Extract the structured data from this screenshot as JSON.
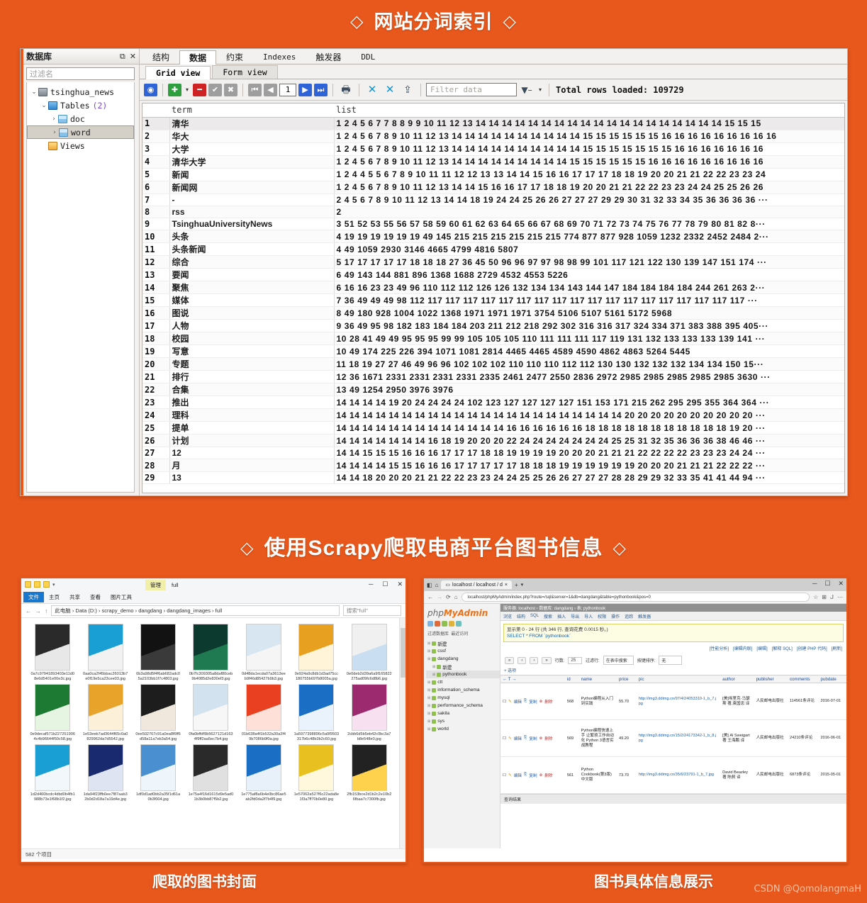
{
  "titles": {
    "section1": "网站分词索引",
    "section2": "使用Scrapy爬取电商平台图书信息",
    "diamond": "◇"
  },
  "db_tool": {
    "tree": {
      "header_title": "数据库",
      "header_restore": "⧉",
      "header_close": "✕",
      "filter_placeholder": "过滤名",
      "nodes": [
        {
          "label": "tsinghua_news",
          "icon": "database-icon",
          "arrow": "⌄",
          "indent": 0,
          "count": "",
          "selected": false
        },
        {
          "label": "Tables",
          "icon": "tables-folder-icon",
          "arrow": "⌄",
          "indent": 1,
          "count": "(2)",
          "selected": false
        },
        {
          "label": "doc",
          "icon": "table-icon",
          "arrow": "›",
          "indent": 2,
          "count": "",
          "selected": false
        },
        {
          "label": "word",
          "icon": "table-icon",
          "arrow": "›",
          "indent": 2,
          "count": "",
          "selected": true
        },
        {
          "label": "Views",
          "icon": "views-icon",
          "arrow": "",
          "indent": 1,
          "count": "",
          "selected": false
        }
      ]
    },
    "tabs": [
      {
        "label": "结构",
        "active": false,
        "latin": false
      },
      {
        "label": "数据",
        "active": true,
        "latin": false
      },
      {
        "label": "约束",
        "active": false,
        "latin": false
      },
      {
        "label": "Indexes",
        "active": false,
        "latin": true
      },
      {
        "label": "触发器",
        "active": false,
        "latin": false
      },
      {
        "label": "DDL",
        "active": false,
        "latin": true
      }
    ],
    "subtabs": [
      {
        "label": "Grid view",
        "active": true
      },
      {
        "label": "Form view",
        "active": false
      }
    ],
    "toolbar": {
      "refresh": "◉",
      "add_row": "✚",
      "add_caret": "▾",
      "delete_row": "━",
      "commit": "✔",
      "rollback": "✖",
      "first_page": "⏮",
      "prev_page": "◀",
      "page_number": "1",
      "next_page": "▶",
      "last_page": "⏭",
      "print": "🖶",
      "collapse": "✕",
      "expand": "✕",
      "export": "⇪",
      "filter_placeholder": "Filter data",
      "filter_icon": "funnel-icon",
      "filter_caret": "▾",
      "total_rows": "Total rows loaded: 109729"
    },
    "grid": {
      "columns": [
        "term",
        "list"
      ],
      "rows": [
        {
          "n": "1",
          "term": "清华",
          "list": "1 2 4 5 6 7 7 8 8 9 9 10 11 12 13 14 14 14 14 14 14 14 14 14 14 14 14 14 14 14 14 14 14 14 15 15 15"
        },
        {
          "n": "2",
          "term": "华大",
          "list": "1 2 4 5 6 7 8 9 10 11 12 13 14 14 14 14 14 14 14 14 14 14 15 15 15 15 15 15 16 16 16 16 16 16 16 16 16"
        },
        {
          "n": "3",
          "term": "大学",
          "list": "1 2 4 5 6 7 8 9 10 11 12 13 14 14 14 14 14 14 14 14 14 14 15 15 15 15 15 15 15 16 16 16 16 16 16 16"
        },
        {
          "n": "4",
          "term": "清华大学",
          "list": "1 2 4 5 6 7 8 9 10 11 12 13 14 14 14 14 14 14 14 14 14 15 15 15 15 15 15 16 16 16 16 16 16 16 16 16"
        },
        {
          "n": "5",
          "term": "新闻",
          "list": "1 2 4 4 5 5 6 7 8 9 10 11 11 12 12 13 13 14 14 15 16 16 17 17 17 18 18 19 20 20 21 21 22 22 23 23 24"
        },
        {
          "n": "6",
          "term": "新闻网",
          "list": "1 2 4 5 6 7 8 9 10 11 12 13 14 14 15 16 16 17 17 18 18 19 20 20 21 21 22 22 23 23 24 24 25 25 26 26"
        },
        {
          "n": "7",
          "term": "-",
          "list": "2 4 5 6 7 8 9 10 11 12 13 14 14 18 19 24 24 25 26 26 27 27 27 29 29 30 31 32 33 34 35 36 36 36 36 ···"
        },
        {
          "n": "8",
          "term": "rss",
          "list": "2"
        },
        {
          "n": "9",
          "term": "TsinghuaUniversityNews",
          "list": "3 51 52 53 55 56 57 58 59 60 61 62 63 64 65 66 67 68 69 70 71 72 73 74 75 76 77 78 79 80 81 82 8···"
        },
        {
          "n": "10",
          "term": "头条",
          "list": "4 19 19 19 19 19 19 49 145 215 215 215 215 215 215 774 877 877 928 1059 1232 2332 2452 2484 2···"
        },
        {
          "n": "11",
          "term": "头条新闻",
          "list": "4 49 1059 2930 3146 4665 4799 4816 5807"
        },
        {
          "n": "12",
          "term": "综合",
          "list": "5 17 17 17 17 17 18 18 18 27 36 45 50 96 96 97 97 98 98 99 101 117 121 122 130 139 147 151 174 ···"
        },
        {
          "n": "13",
          "term": "要闻",
          "list": "6 49 143 144 881 896 1368 1688 2729 4532 4553 5226"
        },
        {
          "n": "14",
          "term": "聚焦",
          "list": "6 16 16 23 23 49 96 110 112 112 126 126 132 134 134 143 144 147 184 184 184 184 244 261 263 2···"
        },
        {
          "n": "15",
          "term": "媒体",
          "list": "7 36 49 49 49 98 112 117 117 117 117 117 117 117 117 117 117 117 117 117 117 117 117 117 117 ···"
        },
        {
          "n": "16",
          "term": "图说",
          "list": "8 49 180 928 1004 1022 1368 1971 1971 1971 3754 5106 5107 5161 5172 5968"
        },
        {
          "n": "17",
          "term": "人物",
          "list": "9 36 49 95 98 182 183 184 184 203 211 212 218 292 302 316 316 317 324 334 371 383 388 395 405···"
        },
        {
          "n": "18",
          "term": "校园",
          "list": "10 28 41 49 49 95 95 95 99 99 105 105 105 110 111 111 111 117 119 131 132 133 133 133 139 141 ···"
        },
        {
          "n": "19",
          "term": "写意",
          "list": "10 49 174 225 226 394 1071 1081 2814 4465 4465 4589 4590 4862 4863 5264 5445"
        },
        {
          "n": "20",
          "term": "专题",
          "list": "11 18 19 27 27 46 49 96 96 102 102 102 110 110 110 112 112 130 130 132 132 132 134 134 150 15···"
        },
        {
          "n": "21",
          "term": "排行",
          "list": "12 36 1671 2331 2331 2331 2331 2335 2461 2477 2550 2836 2972 2985 2985 2985 2985 2985 3630 ···"
        },
        {
          "n": "22",
          "term": "合集",
          "list": "13 49 1254 2950 3976 3976"
        },
        {
          "n": "23",
          "term": "推出",
          "list": "14 14 14 14 19 20 24 24 24 24 102 123 127 127 127 127 151 153 171 215 262 295 295 355 364 364 ···"
        },
        {
          "n": "24",
          "term": "理科",
          "list": "14 14 14 14 14 14 14 14 14 14 14 14 14 14 14 14 14 14 14 14 14 14 20 20 20 20 20 20 20 20 20 20 ···"
        },
        {
          "n": "25",
          "term": "提单",
          "list": "14 14 14 14 14 14 14 14 14 14 14 14 14 16 16 16 16 16 16 18 18 18 18 18 18 18 18 18 18 18 19 20 ···"
        },
        {
          "n": "26",
          "term": "计划",
          "list": "14 14 14 14 14 14 14 16 18 19 20 20 20 22 24 24 24 24 24 24 24 25 25 31 32 35 36 36 36 38 46 46 ···"
        },
        {
          "n": "27",
          "term": "12",
          "list": "14 14 15 15 15 16 16 16 17 17 17 18 18 19 19 19 19 20 20 20 21 21 21 22 22 22 22 23 23 23 24 24 ···"
        },
        {
          "n": "28",
          "term": "月",
          "list": "14 14 14 14 15 15 16 16 16 17 17 17 17 17 18 18 18 19 19 19 19 19 19 20 20 20 21 21 21 22 22 22 ···"
        },
        {
          "n": "29",
          "term": "13",
          "list": "14 14 18 20 20 20 21 21 22 22 23 23 24 24 25 25 26 26 27 27 27 28 28 29 29 32 33 35 41 41 44 94 ···"
        }
      ]
    }
  },
  "explorer": {
    "qat_label": "full",
    "ribbon_manage_label": "管理",
    "tabs": [
      "文件",
      "主页",
      "共享",
      "查看",
      "图片工具"
    ],
    "win_buttons": [
      "─",
      "☐",
      "✕"
    ],
    "nav": [
      "←",
      "→",
      "↑"
    ],
    "breadcrumb": "此电脑 › Data (D:) › scrapy_demo › dangdang › dangdang_images › full",
    "search_placeholder": "搜索\"full\"",
    "status": "582 个项目",
    "covers": [
      {
        "color1": "#2a2a2a",
        "color2": "#e8e8e8",
        "name": "0a7c97941893403e11d08e6d5401e00e3c.jpg"
      },
      {
        "color1": "#1a9fd4",
        "color2": "#f2f2f2",
        "name": "0aa0ca2f45bbac26013b7e0f19e5ca23cee03.jpg"
      },
      {
        "color1": "#121212",
        "color2": "#3a3a3a",
        "name": "0b3a98d5f4f6ab682adc05a2103bb1f7c4803.jpg"
      },
      {
        "color1": "#0c3a2e",
        "color2": "#1f7a52",
        "name": "0b7fc309305a8daf80ceb9b4085d2e830ef3.jpg"
      },
      {
        "color1": "#d8e6f2",
        "color2": "#f5f5f5",
        "name": "0d48da1ecda07a3613eeb9f46d85427b9b3.jpg"
      },
      {
        "color1": "#e8a020",
        "color2": "#fff3d8",
        "name": "0e924a9c8db1d3ad75cc180755b697b8005a.jpg"
      },
      {
        "color1": "#f0f0f0",
        "color2": "#c9dff1",
        "name": "0e0deb2d39a6a9f165822275ad09fc6d8b6.jpg"
      },
      {
        "color1": "#1d7a33",
        "color2": "#e6f5e2",
        "name": "0e9decaf571b2272519064c4b96644f50c58.jpg"
      },
      {
        "color1": "#e8a42a",
        "color2": "#fdf0d8",
        "name": "1e53eeb7ad3644f65c0a0829962da7d5542.jpg"
      },
      {
        "color1": "#1d1d1d",
        "color2": "#f0e8dc",
        "name": "0ee502767c91a0ea8f6ff6d58a11a7eb3a54.jpg"
      },
      {
        "color1": "#d3e2ef",
        "color2": "#f7f7f7",
        "name": "0fa0bffdf9b5627121d1634f9ff2aa5ec7b4.jpg"
      },
      {
        "color1": "#e84020",
        "color2": "#ffe0d8",
        "name": "01b638a4f1b532a30a2f49b7086b9f0a.jpg"
      },
      {
        "color1": "#1a6fc4",
        "color2": "#eaf2fb",
        "name": "1a5977398896c5a0f9503317b6c48b3b2c60.jpg"
      },
      {
        "color1": "#9c2a6e",
        "color2": "#f7e0ef",
        "name": "2cbb6d5b5eb42c0bc3a7b8e548e0.jpg"
      },
      {
        "color1": "#1a9fd4",
        "color2": "#f2f7fb",
        "name": "1d2d460bcdc4dbd0b4fb1988b73e1f68b1f2.jpg"
      },
      {
        "color1": "#1a2a6e",
        "color2": "#dfe4f2",
        "name": "1da94f23ffb0ee7f87aab32b0d2d18a7a19d4e.jpg"
      },
      {
        "color1": "#4a8fd0",
        "color2": "#eef5fb",
        "name": "1df0d1ad0bb2a35f1d61a0b3f004.jpg"
      },
      {
        "color1": "#2a2a2a",
        "color2": "#e0e0e0",
        "name": "1e75a4f16d1615d9e5ad01b3b0bb87f5b2.jpg"
      },
      {
        "color1": "#1a6fc4",
        "color2": "#e8f0fa",
        "name": "1e775af8a6b4e0bc86ae5ab2fd0da2f7b4f9.jpg"
      },
      {
        "color1": "#e8c020",
        "color2": "#fff8dc",
        "name": "1e57062a527f6c22ada8e1f3a7ff70b0e80.jpg"
      },
      {
        "color1": "#222222",
        "color2": "#ffd24d",
        "name": "2fb153bce2d1b2c2e10b26fbaa7c7300fb.jpg"
      }
    ]
  },
  "phpmyadmin": {
    "tab_title": "localhost / localhost / d",
    "url": "localhost/phpMyAdmin/index.php?route=/sql&server=1&db=dangdang&table=pythonbook&pos=0",
    "win_buttons": [
      "─",
      "☐",
      "✕"
    ],
    "logo_php": "php",
    "logo_my": "MyAdmin",
    "breadcrumb": "服务器: localhost  ›  数据库: dangdang  ›  表: pythonbook",
    "filter_label": "过滤数据库",
    "recent_label": "最近访问",
    "tree": [
      {
        "label": "新建",
        "indent": 0,
        "selected": false
      },
      {
        "label": "cssf",
        "indent": 0,
        "selected": false
      },
      {
        "label": "dangdang",
        "indent": 0,
        "selected": false
      },
      {
        "label": "新建",
        "indent": 1,
        "selected": false
      },
      {
        "label": "pythonbook",
        "indent": 1,
        "selected": true
      },
      {
        "label": "ctt",
        "indent": 0,
        "selected": false
      },
      {
        "label": "information_schema",
        "indent": 0,
        "selected": false
      },
      {
        "label": "mysql",
        "indent": 0,
        "selected": false
      },
      {
        "label": "performance_schema",
        "indent": 0,
        "selected": false
      },
      {
        "label": "sakila",
        "indent": 0,
        "selected": false
      },
      {
        "label": "sys",
        "indent": 0,
        "selected": false
      },
      {
        "label": "world",
        "indent": 0,
        "selected": false
      }
    ],
    "menu": [
      "浏览",
      "结构",
      "SQL",
      "搜索",
      "插入",
      "导出",
      "导入",
      "权限",
      "操作",
      "追踪",
      "触发器"
    ],
    "result_note": "显示第 0 - 24 行 (共 346 行, 查询花费 0.0015 秒。)",
    "sql_query": "SELECT * FROM `pythonbook`",
    "options": [
      "性能分析",
      "编辑内联",
      "编辑",
      "解释 SQL",
      "创建 PHP 代码",
      "刷新"
    ],
    "nav": {
      "first": "«",
      "prev": "‹",
      "next": "›",
      "last": "»",
      "rows_label": "行数:",
      "rows_value": "25",
      "filter_label": "过滤行:",
      "filter_placeholder": "在表中搜索",
      "sort_label": "按键排序:",
      "sort_value": "无"
    },
    "columns": [
      "id",
      "name",
      "price",
      "pic",
      "author",
      "publisher",
      "comments",
      "pubdate"
    ],
    "action_labels": [
      "编辑",
      "复制",
      "删除"
    ],
    "rows": [
      {
        "id": "568",
        "name": "Python编程从入门到实践",
        "price": "55.70",
        "pic": "http://img3.ddimg.cn/97/4/24053310-1_b_7.jpg",
        "author": "[美]埃里克·马瑟斯 著,袁国忠 译",
        "publisher": "人民邮电出版社",
        "comments": "114561条评论",
        "pubdate": "2016-07-01"
      },
      {
        "id": "569",
        "name": "Python编程快速上手 让繁琐工作自动化 Python 3语言实战教程",
        "price": "49.20",
        "pic": "http://img3.ddimg.cn/15/2/24173342-1_b_8.jpg",
        "author": "[美] Al Sweigart 著 王海鹏 译",
        "publisher": "人民邮电出版社",
        "comments": "24210条评论",
        "pubdate": "2016-06-01"
      },
      {
        "id": "561",
        "name": "Python Cookbook(第3版)中文版",
        "price": "73.70",
        "pic": "http://img3.ddimg.cn/35/6/23791-1_b_7.jpg",
        "author": "David Beazley 著 陈舸 译",
        "publisher": "人民邮电出版社",
        "comments": "6873条评论",
        "pubdate": "2015-05-01"
      }
    ],
    "footer": "查询结果"
  },
  "captions": {
    "left": "爬取的图书封面",
    "right": "图书具体信息展示"
  },
  "watermark": "CSDN @QomolangmaH",
  "colors": {
    "background": "#e8581c",
    "title_text": "#ffffff"
  }
}
